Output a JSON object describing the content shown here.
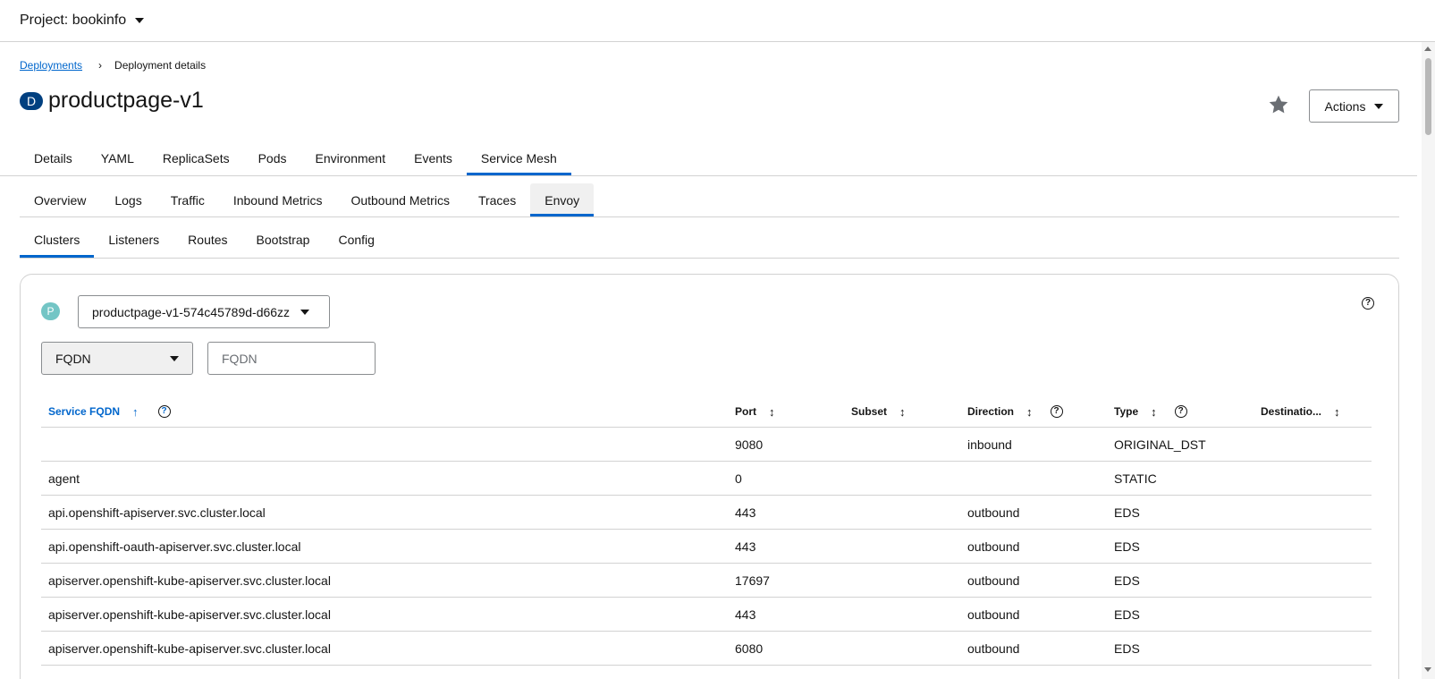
{
  "project": {
    "label": "Project: bookinfo"
  },
  "breadcrumb": {
    "parent": "Deployments",
    "current": "Deployment details"
  },
  "resource": {
    "badge": "D",
    "name": "productpage-v1"
  },
  "actions": {
    "label": "Actions"
  },
  "tabs": [
    {
      "label": "Details",
      "active": false
    },
    {
      "label": "YAML",
      "active": false
    },
    {
      "label": "ReplicaSets",
      "active": false
    },
    {
      "label": "Pods",
      "active": false
    },
    {
      "label": "Environment",
      "active": false
    },
    {
      "label": "Events",
      "active": false
    },
    {
      "label": "Service Mesh",
      "active": true
    }
  ],
  "mesh_tabs": [
    {
      "label": "Overview",
      "active": false
    },
    {
      "label": "Logs",
      "active": false
    },
    {
      "label": "Traffic",
      "active": false
    },
    {
      "label": "Inbound Metrics",
      "active": false
    },
    {
      "label": "Outbound Metrics",
      "active": false
    },
    {
      "label": "Traces",
      "active": false
    },
    {
      "label": "Envoy",
      "active": true
    }
  ],
  "envoy_tabs": [
    {
      "label": "Clusters",
      "active": true
    },
    {
      "label": "Listeners",
      "active": false
    },
    {
      "label": "Routes",
      "active": false
    },
    {
      "label": "Bootstrap",
      "active": false
    },
    {
      "label": "Config",
      "active": false
    }
  ],
  "pod": {
    "badge": "P",
    "selected": "productpage-v1-574c45789d-d66zz"
  },
  "filter": {
    "field": "FQDN",
    "placeholder": "FQDN"
  },
  "table": {
    "columns": {
      "fqdn": "Service FQDN",
      "port": "Port",
      "subset": "Subset",
      "direction": "Direction",
      "type": "Type",
      "destination": "Destinatio..."
    },
    "rows": [
      {
        "fqdn": "",
        "port": "9080",
        "subset": "",
        "direction": "inbound",
        "type": "ORIGINAL_DST",
        "destination": ""
      },
      {
        "fqdn": "agent",
        "port": "0",
        "subset": "",
        "direction": "",
        "type": "STATIC",
        "destination": ""
      },
      {
        "fqdn": "api.openshift-apiserver.svc.cluster.local",
        "port": "443",
        "subset": "",
        "direction": "outbound",
        "type": "EDS",
        "destination": ""
      },
      {
        "fqdn": "api.openshift-oauth-apiserver.svc.cluster.local",
        "port": "443",
        "subset": "",
        "direction": "outbound",
        "type": "EDS",
        "destination": ""
      },
      {
        "fqdn": "apiserver.openshift-kube-apiserver.svc.cluster.local",
        "port": "17697",
        "subset": "",
        "direction": "outbound",
        "type": "EDS",
        "destination": ""
      },
      {
        "fqdn": "apiserver.openshift-kube-apiserver.svc.cluster.local",
        "port": "443",
        "subset": "",
        "direction": "outbound",
        "type": "EDS",
        "destination": ""
      },
      {
        "fqdn": "apiserver.openshift-kube-apiserver.svc.cluster.local",
        "port": "6080",
        "subset": "",
        "direction": "outbound",
        "type": "EDS",
        "destination": ""
      }
    ]
  },
  "icons": {
    "sort_asc": "↑",
    "sort_both": "↕",
    "help": "?",
    "breadcrumb_sep": "›"
  }
}
